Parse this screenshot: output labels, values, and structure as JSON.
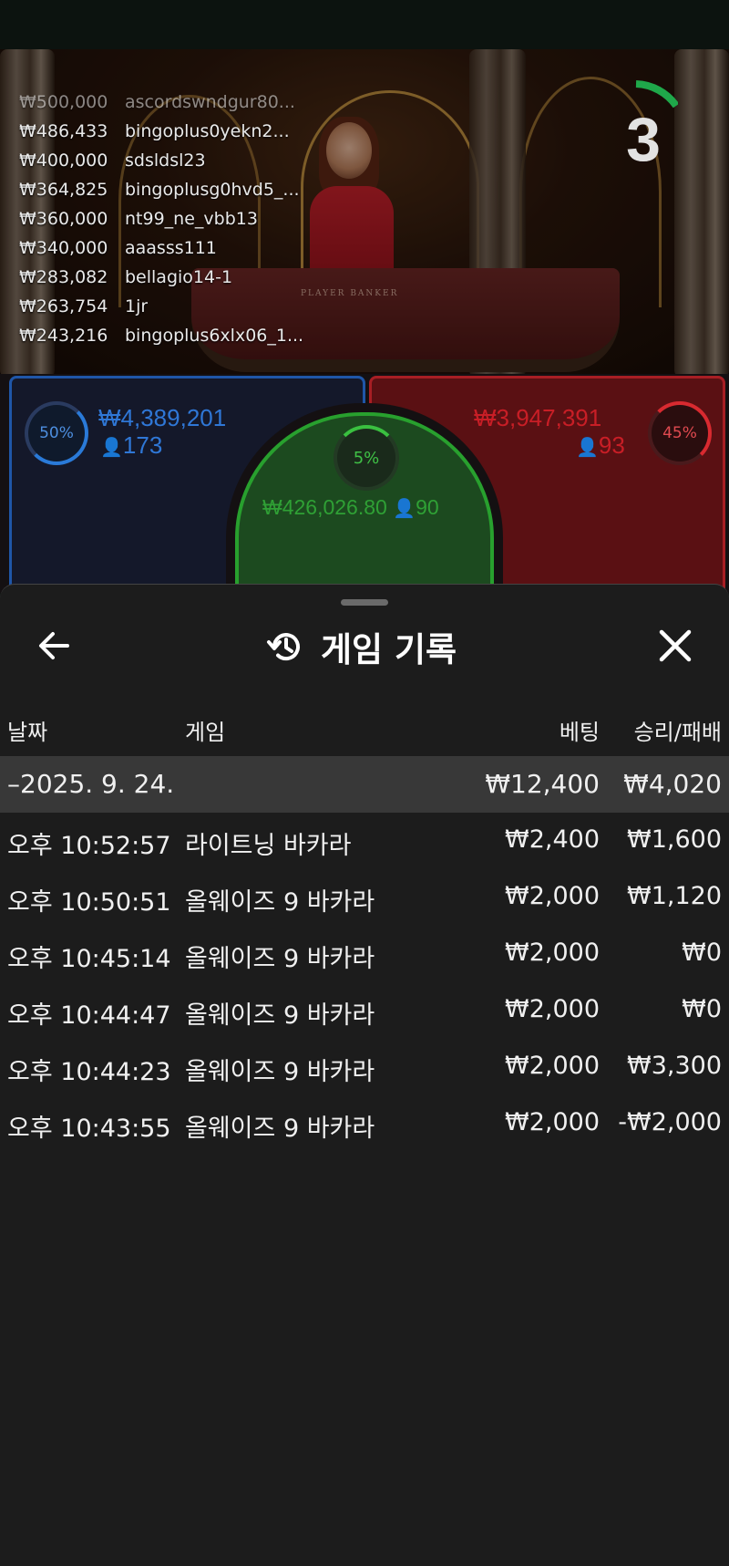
{
  "video": {
    "table_text": "PLAYER      BANKER",
    "countdown": "3",
    "winners": [
      {
        "amount": "₩500,000",
        "user": "ascordswndgur80..."
      },
      {
        "amount": "₩486,433",
        "user": "bingoplus0yekn2..."
      },
      {
        "amount": "₩400,000",
        "user": "sdsldsl23"
      },
      {
        "amount": "₩364,825",
        "user": "bingoplusg0hvd5_..."
      },
      {
        "amount": "₩360,000",
        "user": "nt99_ne_vbb13"
      },
      {
        "amount": "₩340,000",
        "user": "aaasss111"
      },
      {
        "amount": "₩283,082",
        "user": "bellagio14-1"
      },
      {
        "amount": "₩263,754",
        "user": "1jr"
      },
      {
        "amount": "₩243,216",
        "user": "bingoplus6xlx06_1..."
      }
    ]
  },
  "bets": {
    "player": {
      "percent": "50%",
      "amount": "₩4,389,201",
      "count": "173",
      "color": "#2f77d6"
    },
    "banker": {
      "percent": "45%",
      "amount": "₩3,947,391",
      "count": "93",
      "color": "#c81e26"
    },
    "tie": {
      "percent": "5%",
      "amount": "₩426,026.80",
      "count": "90",
      "color": "#2fa035"
    }
  },
  "history": {
    "title": "게임 기록",
    "columns": {
      "date": "날짜",
      "game": "게임",
      "bet": "베팅",
      "winloss": "승리/패배"
    },
    "summary": {
      "date": "–2025. 9. 24.",
      "bet": "₩12,400",
      "winloss": "₩4,020"
    },
    "rows": [
      {
        "time": "오후 10:52:57",
        "game": "라이트닝 바카라",
        "bet": "₩2,400",
        "winloss": "₩1,600"
      },
      {
        "time": "오후 10:50:51",
        "game": "올웨이즈 9 바카라",
        "bet": "₩2,000",
        "winloss": "₩1,120"
      },
      {
        "time": "오후 10:45:14",
        "game": "올웨이즈 9 바카라",
        "bet": "₩2,000",
        "winloss": "₩0"
      },
      {
        "time": "오후 10:44:47",
        "game": "올웨이즈 9 바카라",
        "bet": "₩2,000",
        "winloss": "₩0"
      },
      {
        "time": "오후 10:44:23",
        "game": "올웨이즈 9 바카라",
        "bet": "₩2,000",
        "winloss": "₩3,300"
      },
      {
        "time": "오후 10:43:55",
        "game": "올웨이즈 9 바카라",
        "bet": "₩2,000",
        "winloss": "-₩2,000"
      }
    ]
  }
}
